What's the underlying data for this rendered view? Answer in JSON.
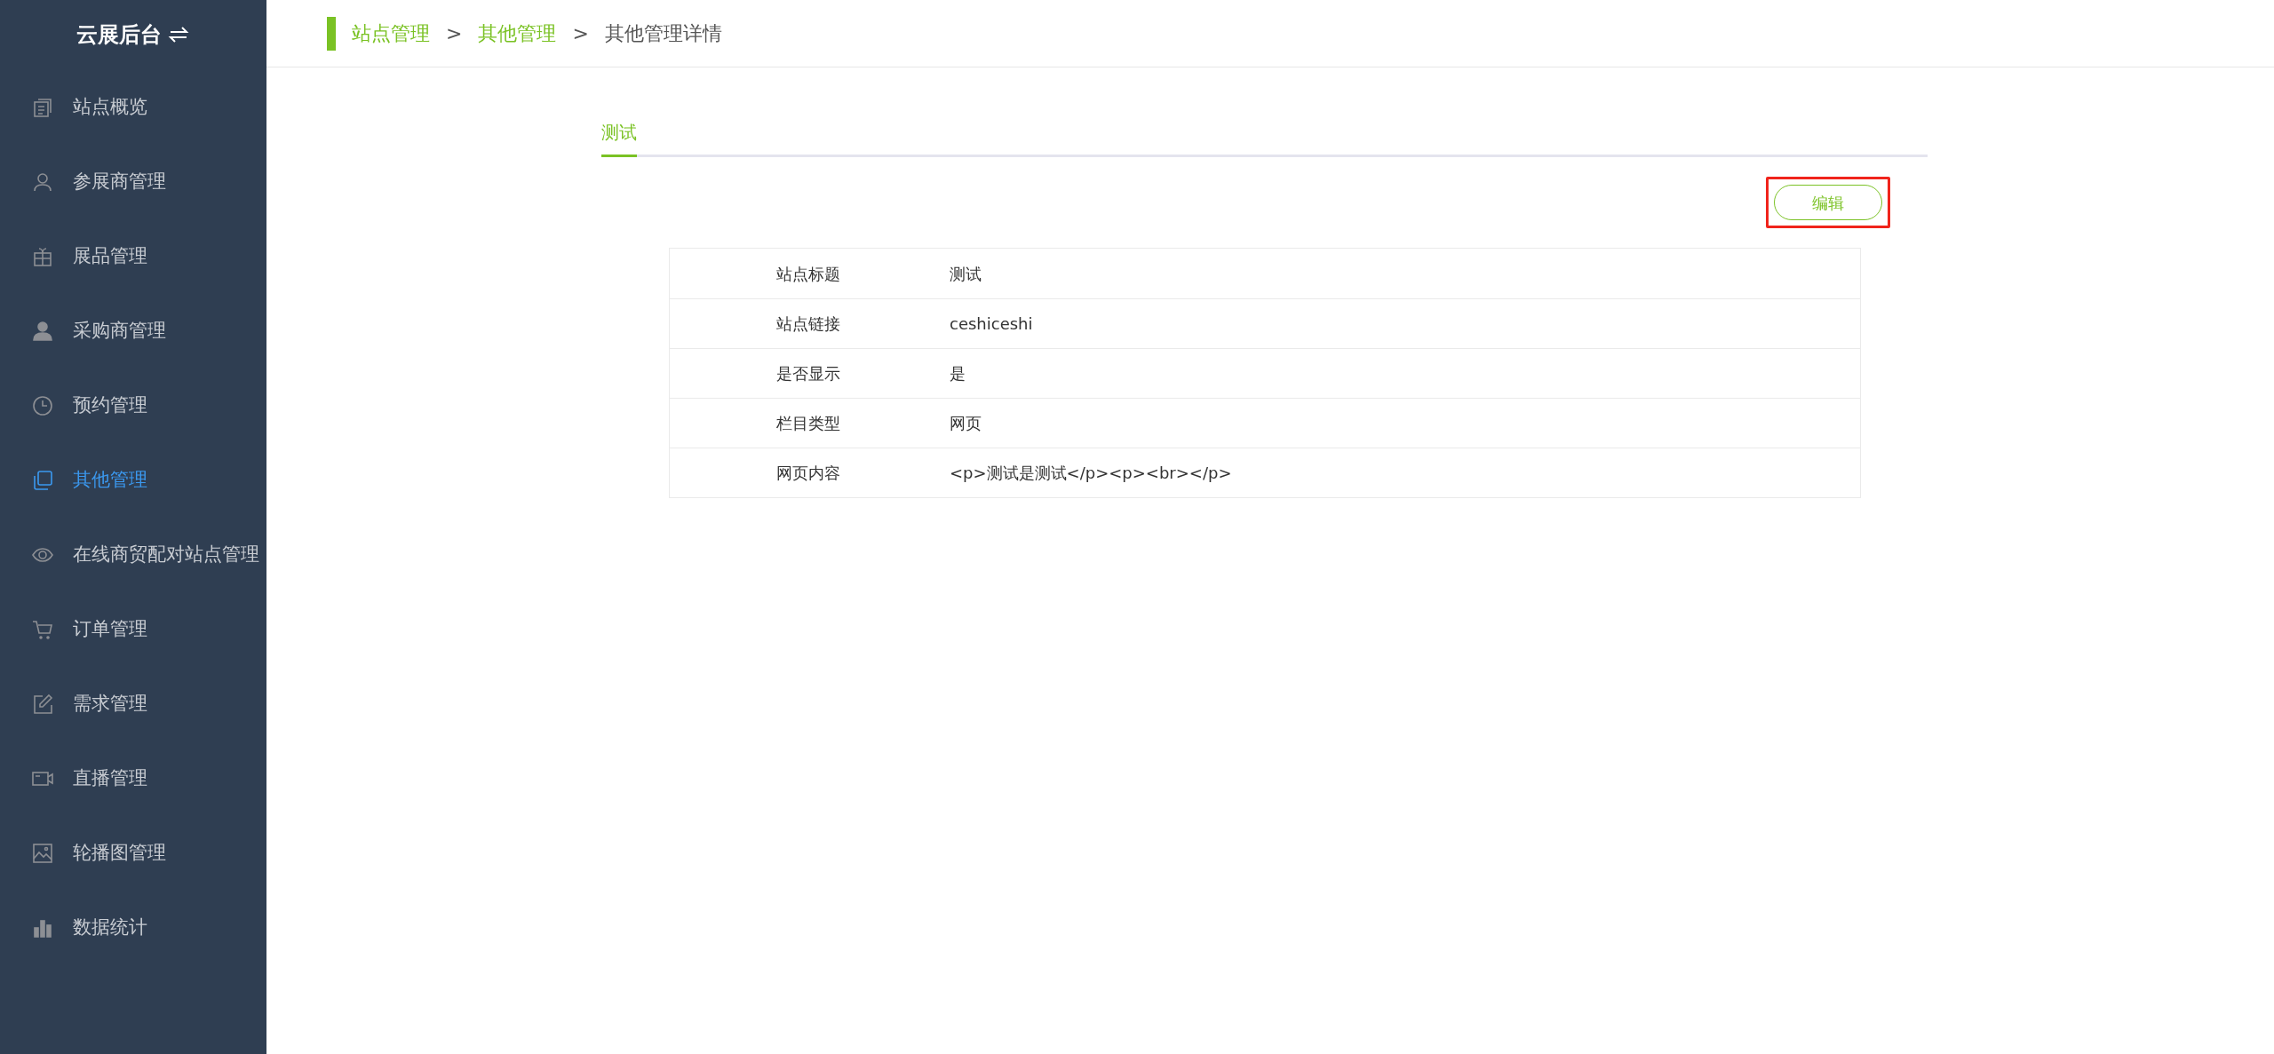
{
  "sidebar": {
    "title": "云展后台",
    "items": [
      {
        "label": "站点概览",
        "selected": false
      },
      {
        "label": "参展商管理",
        "selected": false
      },
      {
        "label": "展品管理",
        "selected": false
      },
      {
        "label": "采购商管理",
        "selected": false
      },
      {
        "label": "预约管理",
        "selected": false
      },
      {
        "label": "其他管理",
        "selected": true
      },
      {
        "label": "在线商贸配对站点管理",
        "selected": false
      },
      {
        "label": "订单管理",
        "selected": false
      },
      {
        "label": "需求管理",
        "selected": false
      },
      {
        "label": "直播管理",
        "selected": false
      },
      {
        "label": "轮播图管理",
        "selected": false
      },
      {
        "label": "数据统计",
        "selected": false
      }
    ]
  },
  "breadcrumb": [
    {
      "label": "站点管理",
      "link": true
    },
    {
      "label": "其他管理",
      "link": true
    },
    {
      "label": "其他管理详情",
      "link": false
    }
  ],
  "breadcrumb_separator": ">",
  "tabs": [
    {
      "label": "测试",
      "selected": true
    }
  ],
  "edit_button": {
    "label": "编辑",
    "highlighted": true
  },
  "details": [
    {
      "label": "站点标题",
      "value": "测试"
    },
    {
      "label": "站点链接",
      "value": "ceshiceshi"
    },
    {
      "label": "是否显示",
      "value": "是"
    },
    {
      "label": "栏目类型",
      "value": "网页"
    },
    {
      "label": "网页内容",
      "value": "<p>测试是测试</p><p><br></p>"
    }
  ]
}
